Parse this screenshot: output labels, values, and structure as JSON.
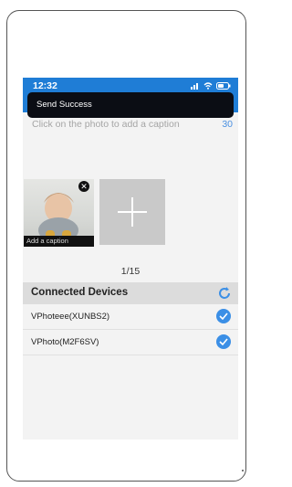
{
  "status_bar": {
    "time": "12:32"
  },
  "toast": {
    "message": "Send Success"
  },
  "caption": {
    "hint": "Click on the photo to add a caption",
    "count": "30"
  },
  "photo": {
    "caption_placeholder": "Add a caption"
  },
  "counter": "1/15",
  "devices": {
    "title": "Connected Devices",
    "items": [
      {
        "name": "VPhoteee(XUNBS2)",
        "checked": true
      },
      {
        "name": "VPhoto(M2F6SV)",
        "checked": true
      }
    ]
  },
  "colors": {
    "accent": "#1f7dd6",
    "check": "#3b8fe6",
    "toast_bg": "#0b0d14"
  }
}
